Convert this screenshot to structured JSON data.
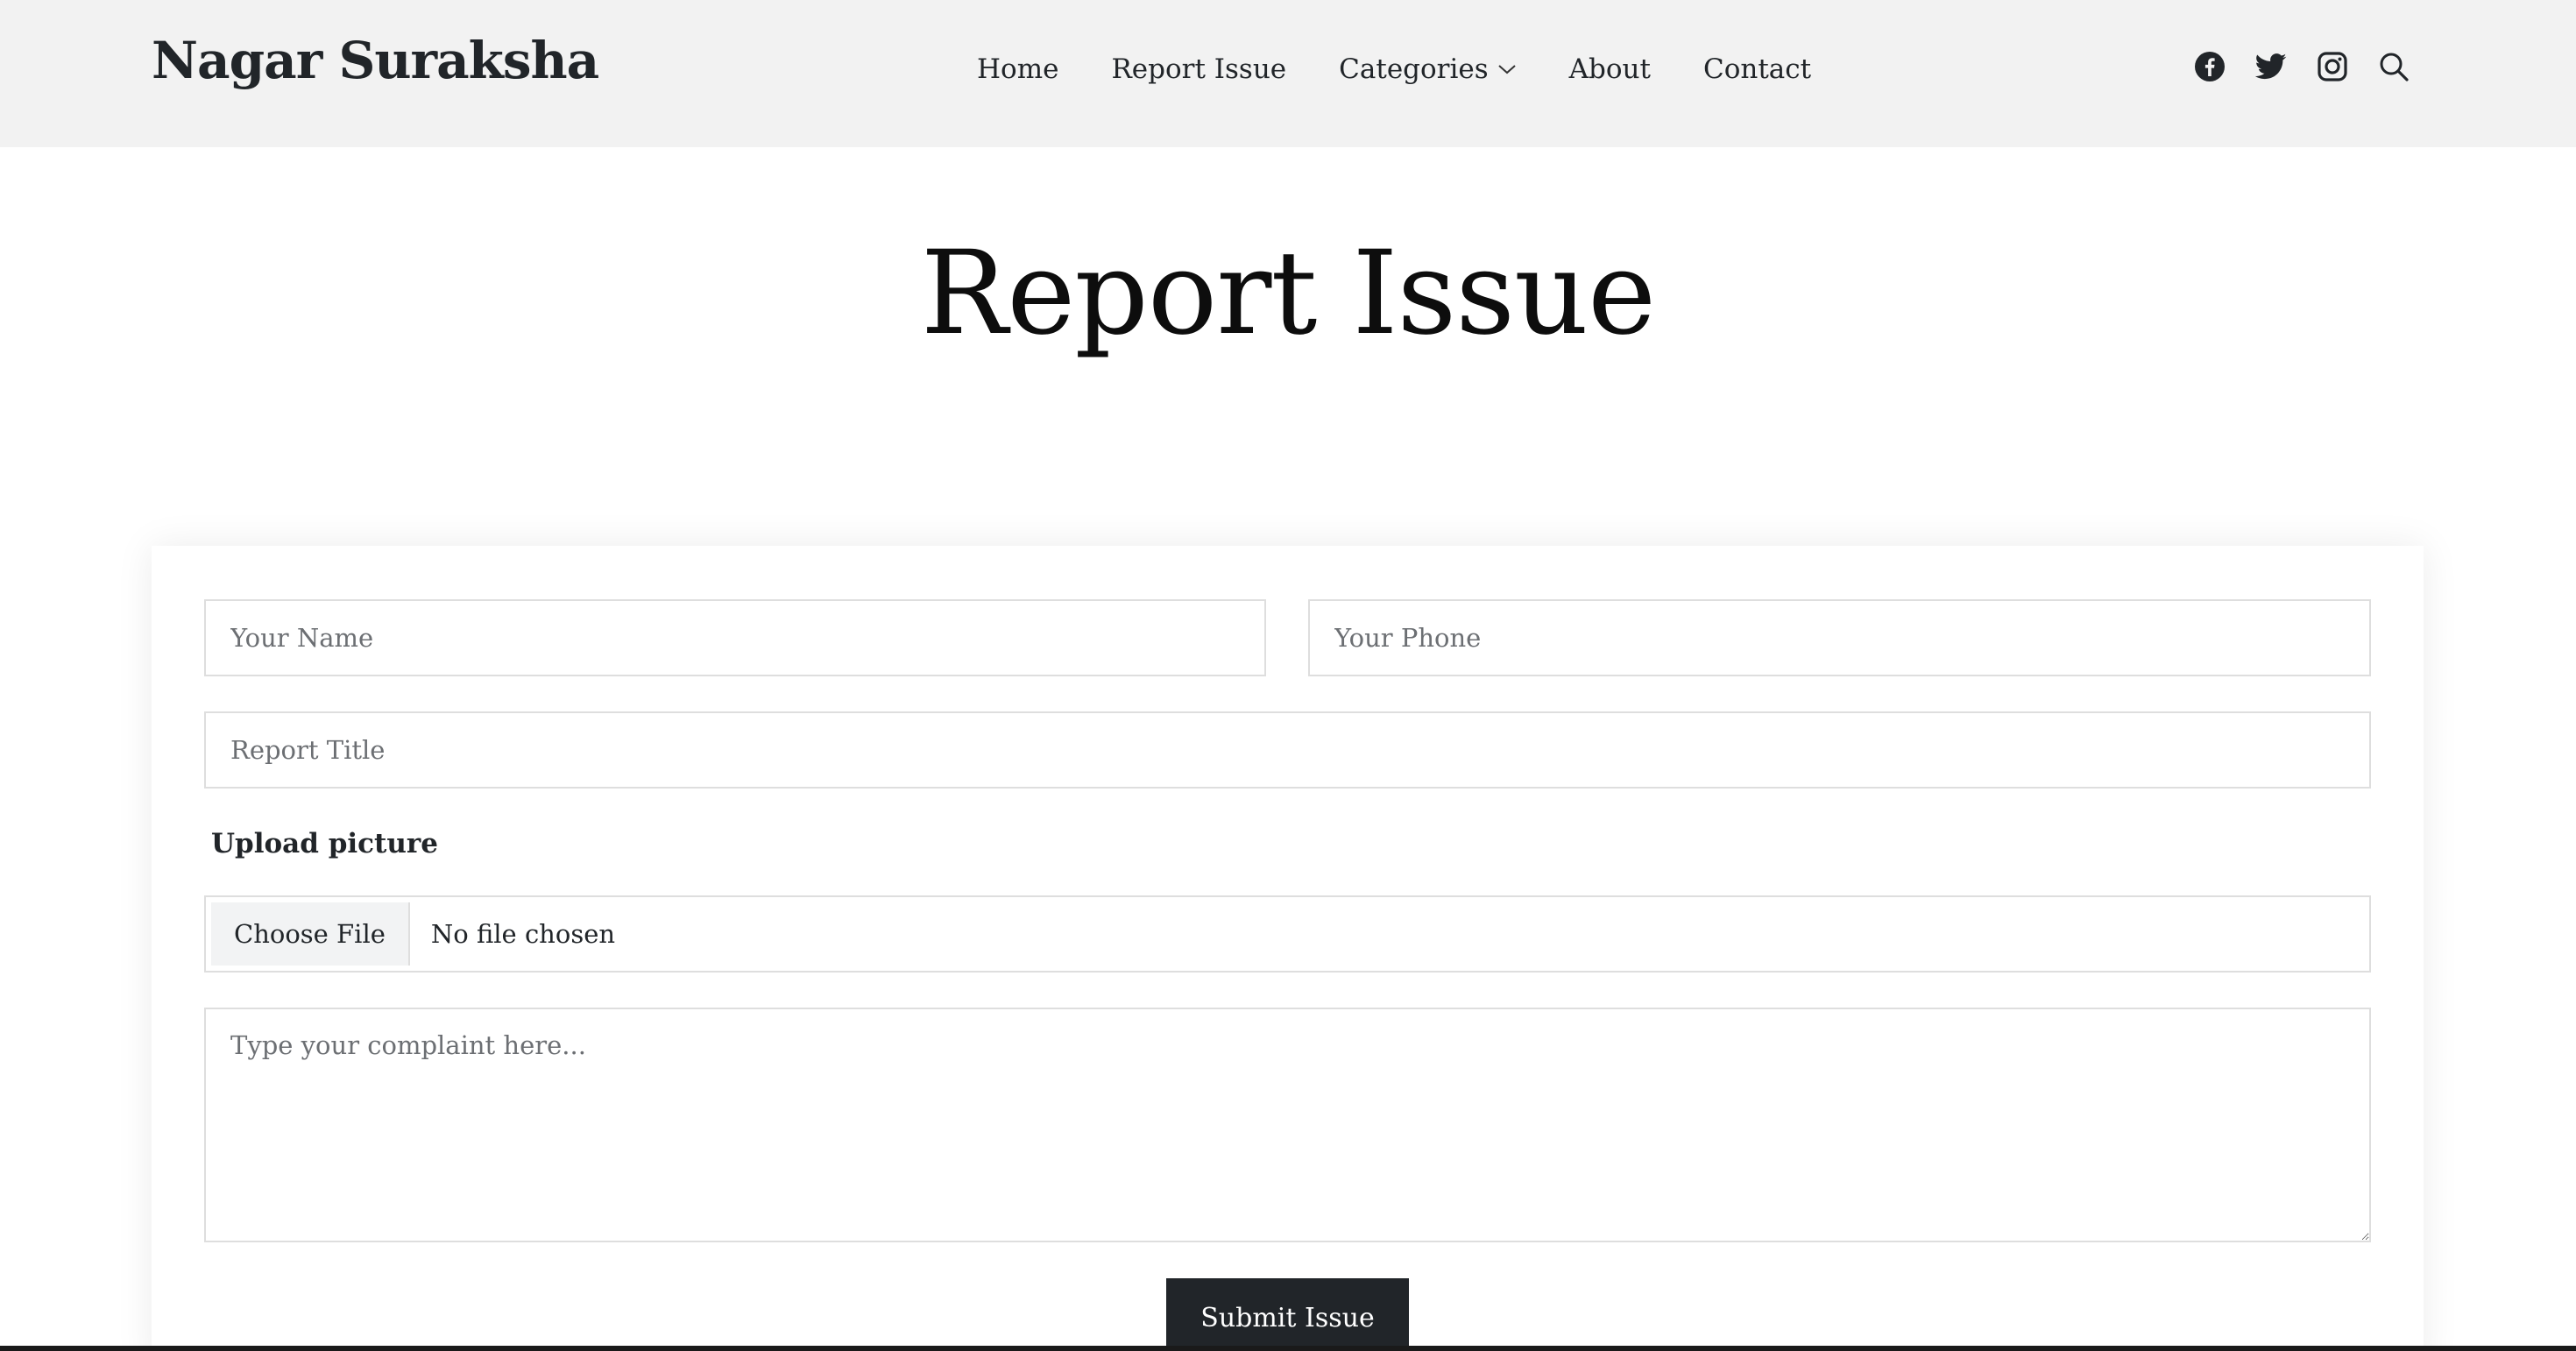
{
  "brand": "Nagar Suraksha",
  "nav": {
    "items": [
      {
        "label": "Home"
      },
      {
        "label": "Report Issue"
      },
      {
        "label": "Categories"
      },
      {
        "label": "About"
      },
      {
        "label": "Contact"
      }
    ]
  },
  "social": {
    "icons": [
      "facebook-icon",
      "twitter-icon",
      "instagram-icon",
      "search-icon"
    ]
  },
  "page": {
    "title": "Report Issue"
  },
  "form": {
    "name_placeholder": "Your Name",
    "phone_placeholder": "Your Phone",
    "title_placeholder": "Report Title",
    "upload_label": "Upload picture",
    "choose_file_label": "Choose File",
    "file_status": "No file chosen",
    "complaint_placeholder": "Type your complaint here...",
    "submit_label": "Submit Issue"
  },
  "colors": {
    "header_bg": "#f2f2f2",
    "button_bg": "#212529",
    "button_text": "#ffffff"
  }
}
